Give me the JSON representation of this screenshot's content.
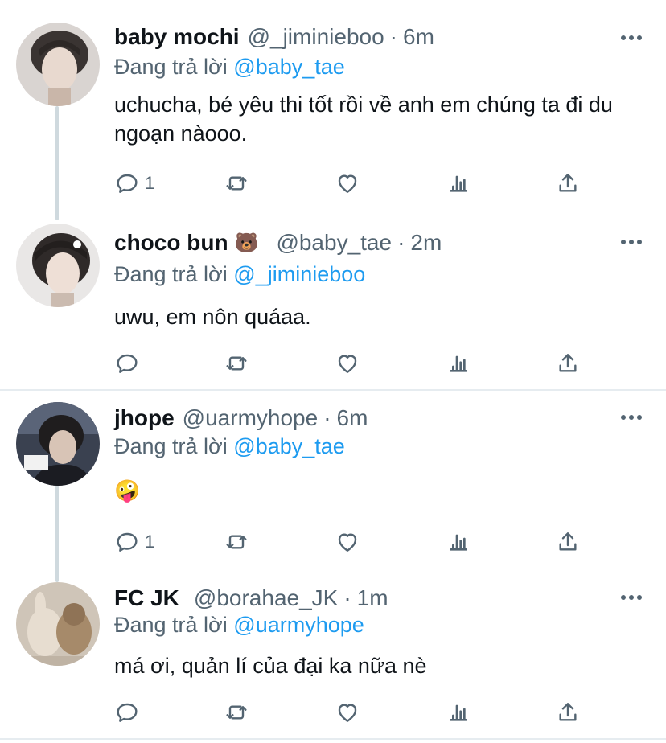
{
  "tweets": [
    {
      "name": "baby mochi",
      "name_emoji": "",
      "handle": "@_jiminieboo",
      "dot": "·",
      "time": "6m",
      "reply_prefix": "Đang trả lời",
      "reply_mention": "@baby_tae",
      "text": "uchucha, bé yêu thi tốt rồi về anh em chúng ta đi du ngoạn nàooo.",
      "reply_count": "1",
      "avatar_icon": "person-photo-avatar"
    },
    {
      "name": "choco bun",
      "name_emoji": "🐻",
      "handle": "@baby_tae",
      "dot": "·",
      "time": "2m",
      "reply_prefix": "Đang trả lời",
      "reply_mention": "@_jiminieboo",
      "text": "uwu, em nôn quáaa.",
      "reply_count": "",
      "avatar_icon": "person-photo-avatar"
    },
    {
      "name": "jhope",
      "name_emoji": "",
      "handle": "@uarmyhope",
      "dot": "·",
      "time": "6m",
      "reply_prefix": "Đang trả lời",
      "reply_mention": "@baby_tae",
      "text": "🤪",
      "reply_count": "1",
      "avatar_icon": "person-photo-avatar"
    },
    {
      "name": "FC JK",
      "name_emoji": "",
      "handle": "@borahae_JK",
      "dot": "·",
      "time": "1m",
      "reply_prefix": "Đang trả lời",
      "reply_mention": "@uarmyhope",
      "text": "má ơi, quản lí của đại ka nữa nè",
      "reply_count": "",
      "avatar_icon": "plush-toys-avatar"
    }
  ],
  "colors": {
    "accent": "#1d9bf0",
    "secondary_text": "#536471",
    "thread_line": "#cfd9de"
  }
}
